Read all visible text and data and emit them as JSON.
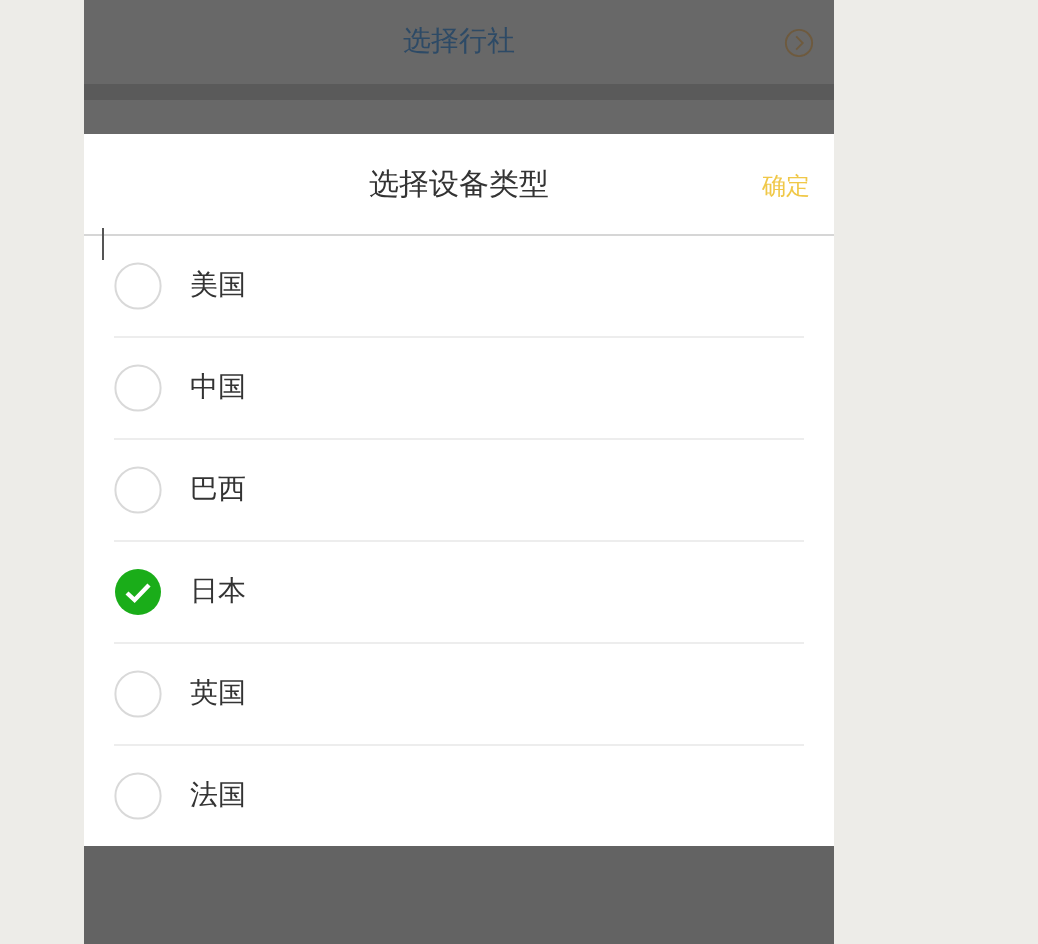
{
  "background_list": [
    {
      "label": "选择行社"
    }
  ],
  "sheet": {
    "title": "选择设备类型",
    "confirm": "确定"
  },
  "options": [
    {
      "label": "美国",
      "selected": false
    },
    {
      "label": "中国",
      "selected": false
    },
    {
      "label": "巴西",
      "selected": false
    },
    {
      "label": "日本",
      "selected": true
    },
    {
      "label": "英国",
      "selected": false
    },
    {
      "label": "法国",
      "selected": false
    }
  ]
}
